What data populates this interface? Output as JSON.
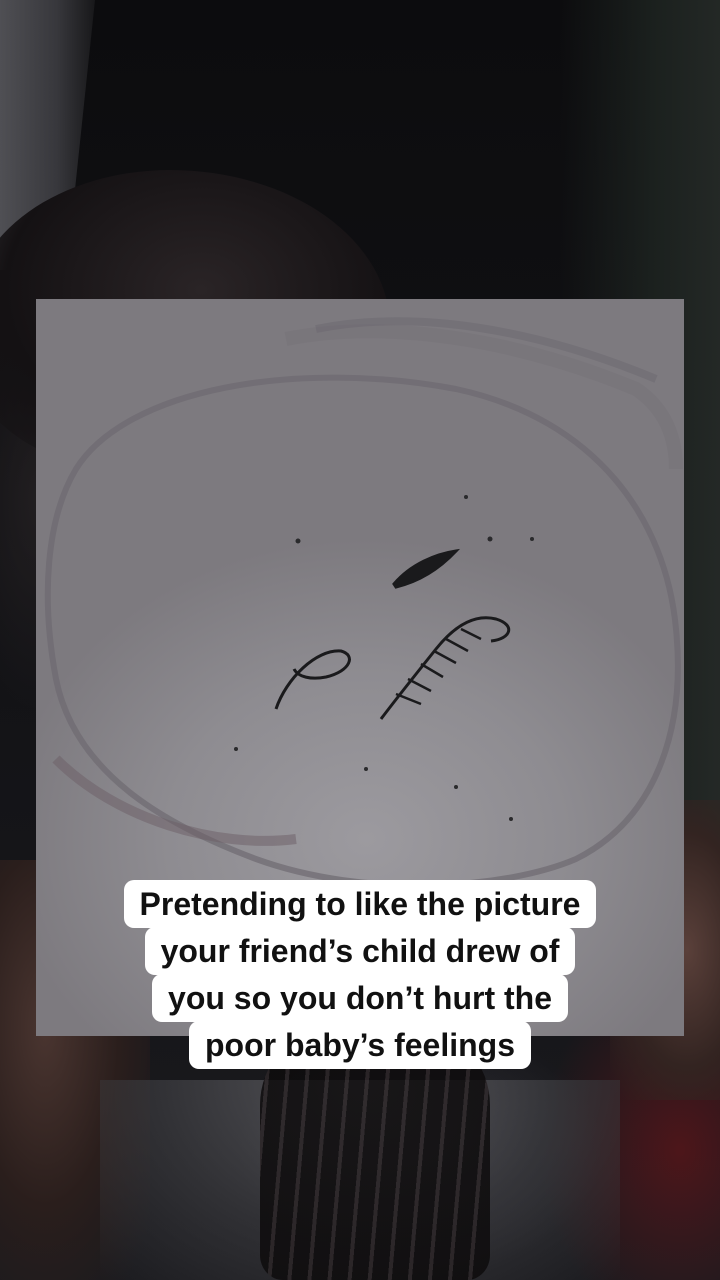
{
  "caption": {
    "lines": [
      "Pretending to like the picture",
      "your friend’s child drew of",
      "you so you don’t hurt the",
      "poor baby’s feelings"
    ],
    "background_color": "#ffffff",
    "text_color": "#111111"
  },
  "scene": {
    "subject": "child's pencil drawing of a face held up in front of a person",
    "dominant_colors": [
      "#0b0b0d",
      "#8e8c91",
      "#5a403a"
    ]
  }
}
